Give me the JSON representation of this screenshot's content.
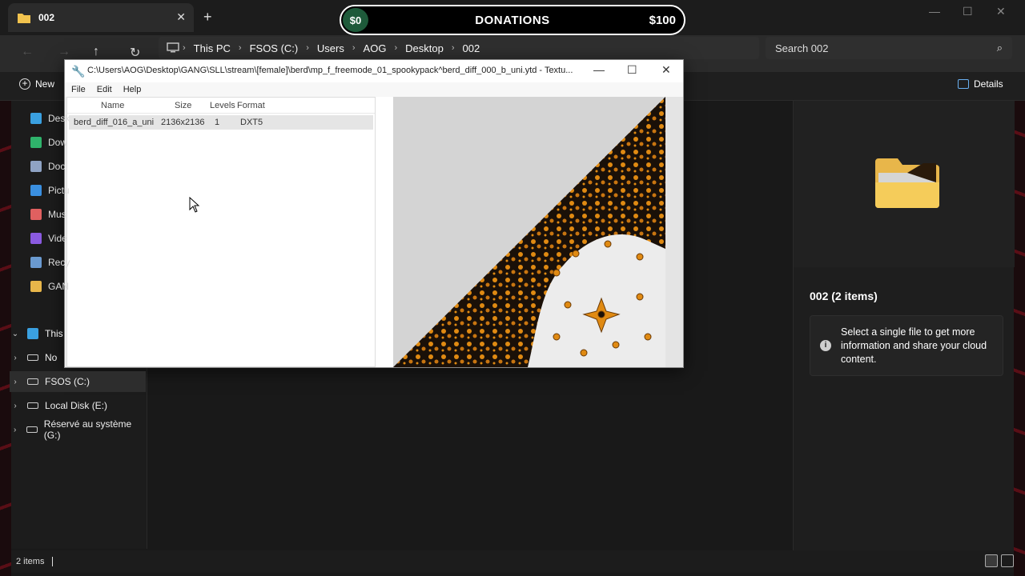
{
  "tab": {
    "title": "002"
  },
  "donation": {
    "current": "$0",
    "title": "DONATIONS",
    "goal": "$100"
  },
  "breadcrumbs": [
    "This PC",
    "FSOS (C:)",
    "Users",
    "AOG",
    "Desktop",
    "002"
  ],
  "search": {
    "placeholder": "Search 002"
  },
  "commandbar": {
    "new_label": "New",
    "details_label": "Details"
  },
  "sidebar": {
    "quick_access": [
      {
        "label": "Desk",
        "icon": "desktop-icon",
        "color": "#3aa0e0"
      },
      {
        "label": "Dow",
        "icon": "download-icon",
        "color": "#2fb36b"
      },
      {
        "label": "Doc",
        "icon": "document-icon",
        "color": "#8fa3c4"
      },
      {
        "label": "Pictu",
        "icon": "pictures-icon",
        "color": "#3a8fe0"
      },
      {
        "label": "Mus",
        "icon": "music-icon",
        "color": "#e06060"
      },
      {
        "label": "Vide",
        "icon": "video-icon",
        "color": "#8a5ae0"
      },
      {
        "label": "Recy",
        "icon": "recycle-bin-icon",
        "color": "#6a9ad0"
      },
      {
        "label": "GAN",
        "icon": "folder-icon",
        "color": "#e8b64a"
      }
    ],
    "tree": [
      {
        "label": "This",
        "expanded": true
      },
      {
        "label": "No",
        "expanded": false
      },
      {
        "label": "FSOS (C:)",
        "expanded": false,
        "selected": true
      },
      {
        "label": "Local Disk (E:)",
        "expanded": false
      },
      {
        "label": "Réservé au système (G:)",
        "expanded": false
      }
    ]
  },
  "details_pane": {
    "title": "002 (2 items)",
    "info": "Select a single file to get more information and share your cloud content."
  },
  "statusbar": {
    "count": "2 items"
  },
  "texture_window": {
    "title": "C:\\Users\\AOG\\Desktop\\GANG\\SLL\\stream\\[female]\\berd\\mp_f_freemode_01_spookypack^berd_diff_000_b_uni.ytd - Textu...",
    "menu": [
      "File",
      "Edit",
      "Help"
    ],
    "columns": [
      "Name",
      "Size",
      "Levels",
      "Format"
    ],
    "rows": [
      {
        "name": "berd_diff_016_a_uni",
        "size": "2136x2136",
        "levels": "1",
        "format": "DXT5"
      }
    ]
  },
  "colors": {
    "accent_orange": "#e08a12",
    "dark_pattern": "#1a1008",
    "bg": "#191919"
  }
}
